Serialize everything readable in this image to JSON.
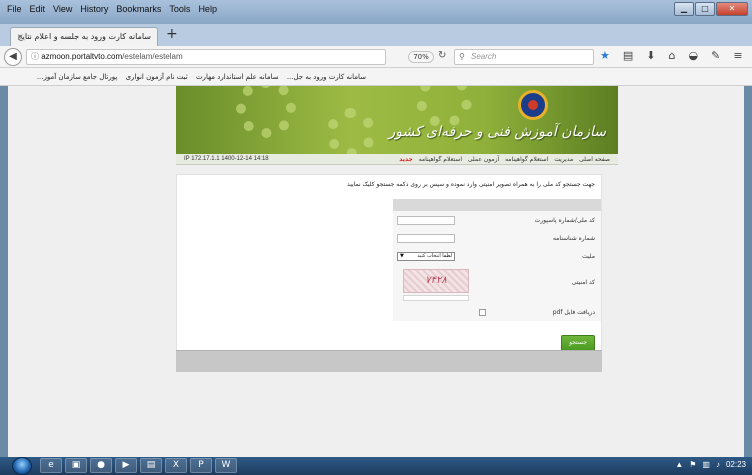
{
  "browser": {
    "menu": [
      "File",
      "Edit",
      "View",
      "History",
      "Bookmarks",
      "Tools",
      "Help"
    ],
    "tab_title": "سامانه کارت ورود به جلسه و اعلام نتایج",
    "tab_close": "×",
    "new_tab": "+",
    "url_host": "azmoon.portaltvto.com",
    "url_path": "/estelam/estelam",
    "zoom": "70%",
    "search_placeholder": "Search",
    "bookmarks": [
      "سامانه کارت ورود به جل...",
      "سامانه علم استاندارد مهارت",
      "ثبت نام آزمون انواری",
      "پورتال جامع سازمان آموز..."
    ]
  },
  "header": {
    "org_name": "سازمان آموزش فنی و حرفه‌ای کشور",
    "ip_info": "IP 172.17.1.1    1400-12-14 14:18",
    "nav_links": [
      "صفحه اصلی",
      "مدیریت",
      "استعلام گواهینامه",
      "آزمون عملی",
      "استعلام گواهینامه"
    ],
    "nav_new": "جدید"
  },
  "form": {
    "instruction": "جهت جستجو کد ملی را به همراه تصویر امنیتی وارد نموده و سپس بر روی دکمه جستجو کلیک نمایید",
    "national_code_label": "کد ملی/شماره پاسپورت",
    "certificate_label": "شماره شناسنامه",
    "nationality_label": "ملیت",
    "nationality_value": "لطفا انتخاب کنید",
    "captcha_label": "کد امنیتی",
    "captcha_text": "۷۴۲۸",
    "download_label": "دریافت فایل pdf",
    "search_button": "جستجو"
  },
  "taskbar": {
    "clock": "02:23"
  }
}
